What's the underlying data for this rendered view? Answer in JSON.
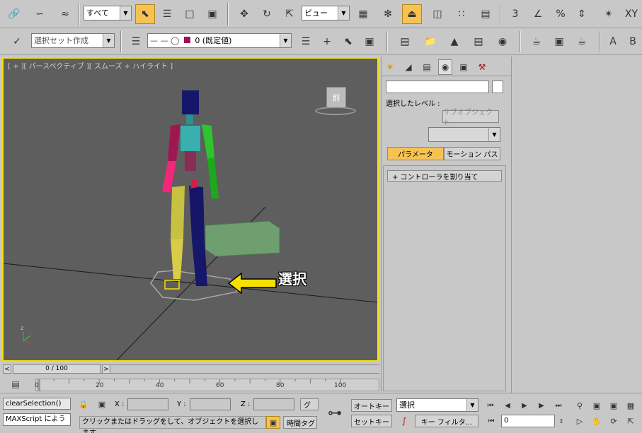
{
  "toolbar1": {
    "selection_filter": "すべて",
    "reference_coord": "ビュー"
  },
  "toolbar2": {
    "named_selection_set": "選択セット作成",
    "layer_name": "0 (既定値)"
  },
  "viewport": {
    "label": "[ + ][ パースペクティブ ][ スムーズ + ハイライト ]",
    "viewcube_face": "前",
    "annotation": "選択"
  },
  "command_panel": {
    "selected_level_label": "選択したレベル :",
    "subobject_button": "サブオブジェクト",
    "tab_parameters": "パラメータ",
    "tab_motion_paths": "モーション パス",
    "rollout_assign_controller": "+    コントローラを割り当て"
  },
  "time_slider": {
    "label": "0 / 100",
    "prev": "<",
    "next": ">",
    "ticks": [
      "0",
      "20",
      "40",
      "60",
      "80",
      "100"
    ]
  },
  "status": {
    "maxscript_line1": "clearSelection()",
    "maxscript_line2": "MAXScript によう",
    "prompt": "クリックまたはドラッグをして、オブジェクトを選択します",
    "x_label": "X :",
    "y_label": "Y :",
    "z_label": "Z :",
    "grid_label": "グ",
    "time_tag": "時間タグ",
    "auto_key": "オートキー",
    "set_key": "セットキー",
    "key_mode_selected": "選択",
    "key_filters": "キー フィルタ...",
    "current_frame": "0"
  },
  "colors": {
    "viewport_border": "#f5e000",
    "active_button": "#f6c352",
    "annotation_arrow": "#f5e000"
  }
}
